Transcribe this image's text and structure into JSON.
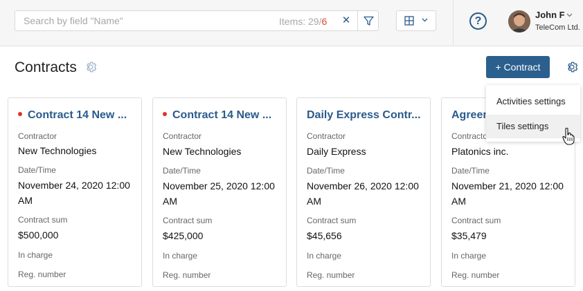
{
  "search": {
    "placeholder": "Search by field \"Name\"",
    "items_label": "Items: 29",
    "items_separator": "/",
    "items_selected": "6"
  },
  "user": {
    "name": "John F",
    "company": "TeleCom Ltd."
  },
  "page": {
    "title": "Contracts",
    "add_button": "+ Contract"
  },
  "settings_menu": {
    "items": [
      "Activities settings",
      "Tiles settings"
    ]
  },
  "field_labels": {
    "contractor": "Contractor",
    "datetime": "Date/Time",
    "sum": "Contract sum",
    "in_charge": "In charge",
    "reg_number": "Reg. number"
  },
  "cards": [
    {
      "title": "Contract 14 New ...",
      "contractor": "New Technologies",
      "datetime": "November 24, 2020 12:00 AM",
      "sum": "$500,000"
    },
    {
      "title": "Contract 14 New ...",
      "contractor": "New Technologies",
      "datetime": "November 25, 2020 12:00 AM",
      "sum": "$425,000"
    },
    {
      "title": "Daily Express Contr...",
      "contractor": "Daily Express",
      "datetime": "November 26, 2020 12:00 AM",
      "sum": "$45,656"
    },
    {
      "title": "Agreem",
      "contractor": "Platonics inc.",
      "datetime": "November 21, 2020 12:00 AM",
      "sum": "$35,479"
    }
  ],
  "colors": {
    "accent": "#2b5f8e",
    "link": "#2a5b8c",
    "alert_dot": "#d9342b",
    "selected_count": "#e0452a"
  }
}
